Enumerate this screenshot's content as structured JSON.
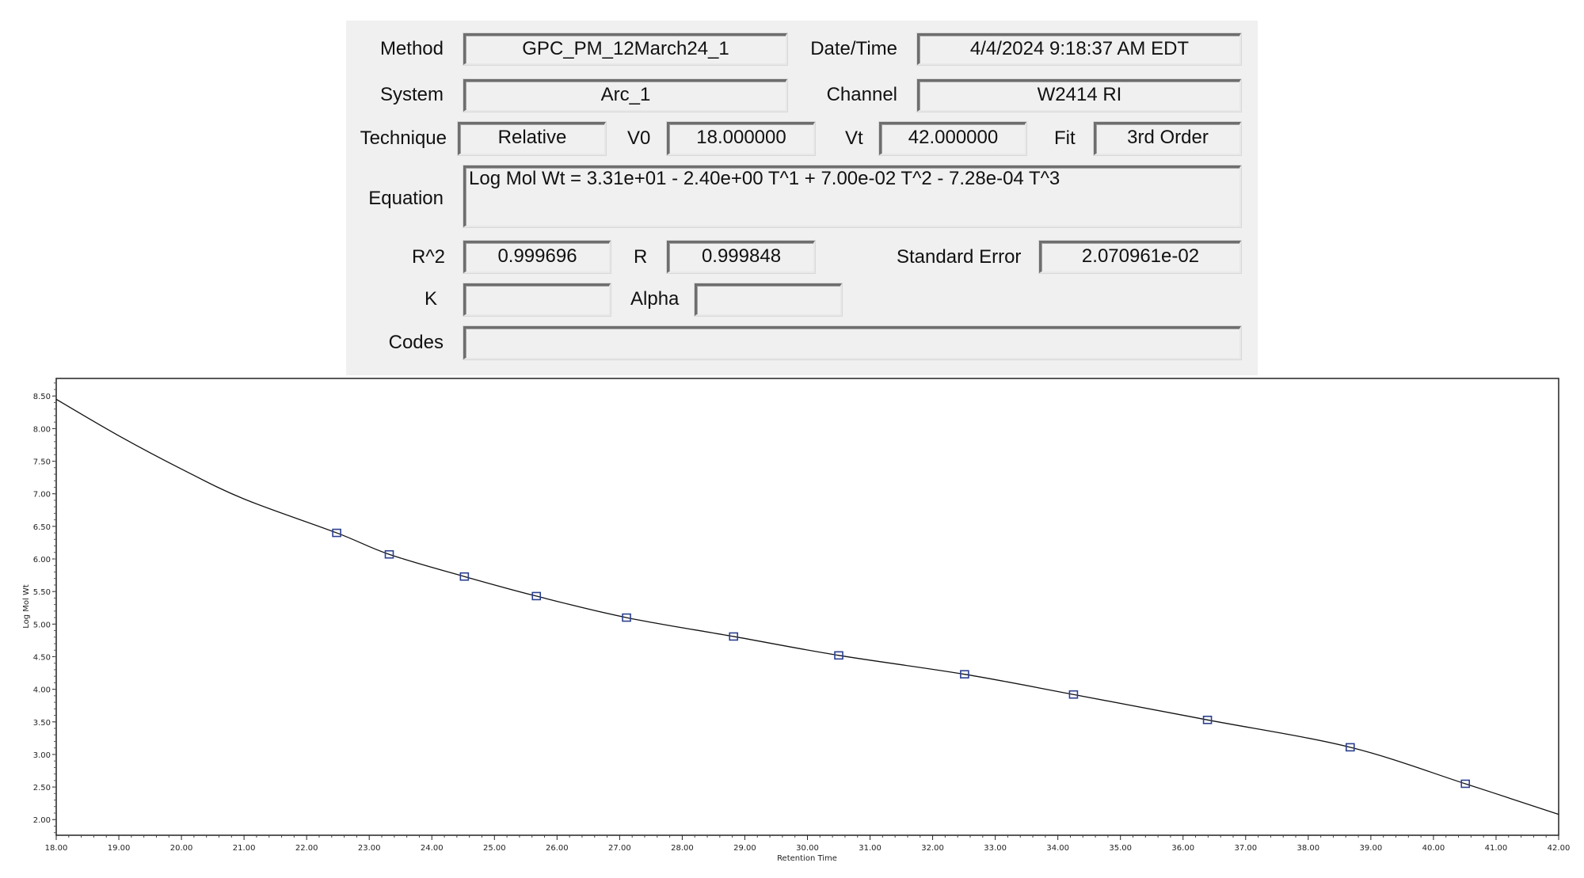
{
  "panel": {
    "method": {
      "label": "Method",
      "value": "GPC_PM_12March24_1"
    },
    "datetime": {
      "label": "Date/Time",
      "value": "4/4/2024 9:18:37 AM EDT"
    },
    "system": {
      "label": "System",
      "value": "Arc_1"
    },
    "channel": {
      "label": "Channel",
      "value": "W2414 RI"
    },
    "technique": {
      "label": "Technique",
      "value": "Relative"
    },
    "v0": {
      "label": "V0",
      "value": "18.000000"
    },
    "vt": {
      "label": "Vt",
      "value": "42.000000"
    },
    "fit": {
      "label": "Fit",
      "value": "3rd Order"
    },
    "equation": {
      "label": "Equation",
      "value": "Log Mol Wt = 3.31e+01 - 2.40e+00 T^1 + 7.00e-02 T^2 - 7.28e-04 T^3"
    },
    "r2": {
      "label": "R^2",
      "value": "0.999696"
    },
    "r": {
      "label": "R",
      "value": "0.999848"
    },
    "std_error": {
      "label": "Standard Error",
      "value": "2.070961e-02"
    },
    "k": {
      "label": "K",
      "value": ""
    },
    "alpha": {
      "label": "Alpha",
      "value": ""
    },
    "codes": {
      "label": "Codes",
      "value": ""
    }
  },
  "chart_data": {
    "type": "scatter",
    "xlabel": "Retention  Time",
    "ylabel": "Log Mol Wt",
    "xlim": [
      18,
      42
    ],
    "ylim": [
      1.76,
      8.77
    ],
    "x_ticks": [
      "18.00",
      "19.00",
      "20.00",
      "21.00",
      "22.00",
      "23.00",
      "24.00",
      "25.00",
      "26.00",
      "27.00",
      "28.00",
      "29.00",
      "30.00",
      "31.00",
      "32.00",
      "33.00",
      "34.00",
      "35.00",
      "36.00",
      "37.00",
      "38.00",
      "39.00",
      "40.00",
      "41.00",
      "42.00"
    ],
    "y_ticks": [
      "2.00",
      "2.50",
      "3.00",
      "3.50",
      "4.00",
      "4.50",
      "5.00",
      "5.50",
      "6.00",
      "6.50",
      "7.00",
      "7.50",
      "8.00",
      "8.50"
    ],
    "grid": false,
    "marker_color": "#2b3f8f",
    "line_color": "#111111",
    "points": {
      "x": [
        22.48,
        23.32,
        24.52,
        25.67,
        27.11,
        28.82,
        30.5,
        32.51,
        34.25,
        36.39,
        38.67,
        40.51
      ],
      "y": [
        6.4,
        6.07,
        5.73,
        5.43,
        5.1,
        4.81,
        4.52,
        4.23,
        3.92,
        3.53,
        3.11,
        2.55
      ]
    },
    "fit_curve": {
      "x": [
        18,
        19,
        20,
        21,
        22.48,
        23.32,
        24.52,
        25.67,
        27.11,
        28.82,
        30.5,
        32.51,
        34.25,
        36.39,
        38.67,
        40.51,
        42
      ],
      "y": [
        8.45,
        7.89,
        7.38,
        6.92,
        6.4,
        6.07,
        5.73,
        5.43,
        5.1,
        4.81,
        4.52,
        4.23,
        3.92,
        3.53,
        3.11,
        2.55,
        2.08
      ]
    }
  }
}
